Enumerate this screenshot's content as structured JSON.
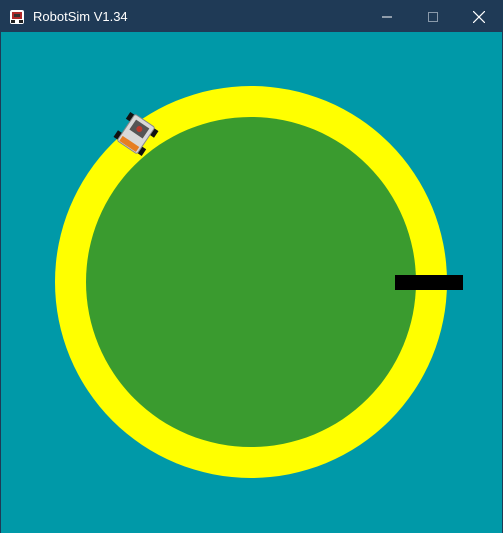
{
  "window": {
    "title": "RobotSim V1.34",
    "icons": {
      "app": "robot-app-icon",
      "minimize": "minimize-icon",
      "maximize": "maximize-icon",
      "close": "close-icon"
    }
  },
  "scene": {
    "background_color": "#0099a8",
    "track_color": "#ffff00",
    "field_color": "#3a9b2f",
    "marker_color": "#000000",
    "robot": {
      "body_color": "#d8d8d8",
      "wheel_color": "#111111",
      "heading_deg": 34
    }
  }
}
